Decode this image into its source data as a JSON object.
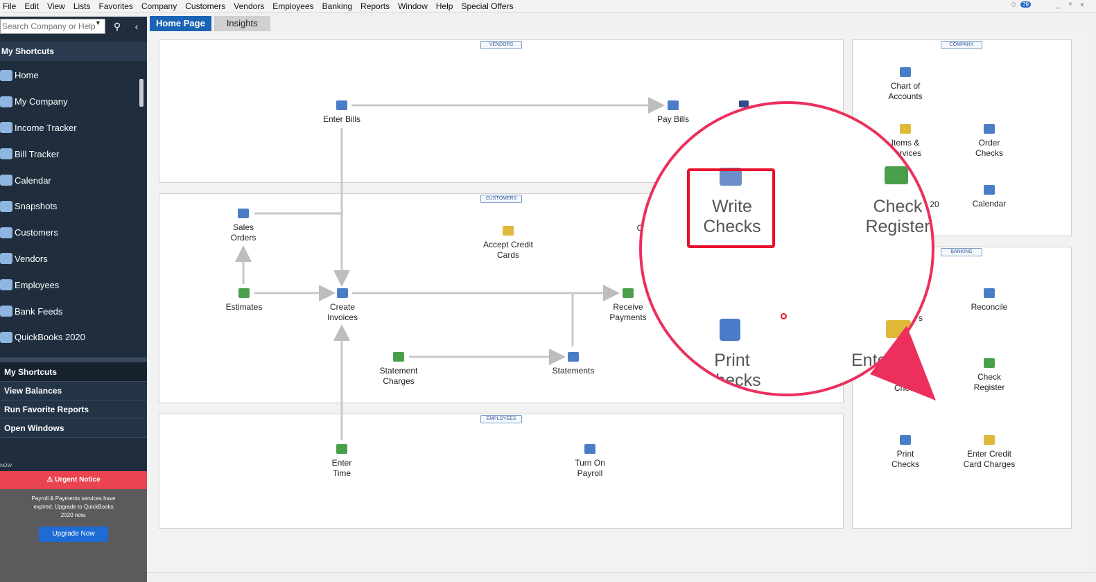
{
  "menu": [
    "File",
    "Edit",
    "View",
    "Lists",
    "Favorites",
    "Company",
    "Customers",
    "Vendors",
    "Employees",
    "Banking",
    "Reports",
    "Window",
    "Help",
    "Special Offers"
  ],
  "window_controls": {
    "badge": "79",
    "minimize": "_",
    "restore": "ᵒ",
    "close": "×"
  },
  "search": {
    "placeholder": "Search Company or Help"
  },
  "sidebar": {
    "header": "My Shortcuts",
    "items": [
      "Home",
      "My Company",
      "Income Tracker",
      "Bill Tracker",
      "Calendar",
      "Snapshots",
      "Customers",
      "Vendors",
      "Employees",
      "Bank Feeds",
      "QuickBooks 2020"
    ],
    "tabs": [
      "My Shortcuts",
      "View Balances",
      "Run Favorite Reports",
      "Open Windows"
    ],
    "now_label": "NOW",
    "notice": {
      "title": "Urgent Notice",
      "text": "Payroll & Payments services have expired. Upgrade to QuickBooks 2020 now.",
      "button": "Upgrade Now"
    }
  },
  "tabs": [
    "Home Page",
    "Insights"
  ],
  "panels": {
    "vendors": "VENDORS",
    "customers": "CUSTOMERS",
    "employees": "EMPLOYEES",
    "company": "COMPANY",
    "banking": "BANKING"
  },
  "nodes": {
    "enter_bills": "Enter Bills",
    "pay_bills": "Pay Bills",
    "sales_orders": "Sales Orders",
    "accept_cc": "Accept Credit Cards",
    "estimates": "Estimates",
    "create_invoices": "Create Invoices",
    "receive_payments": "Receive Payments",
    "statement_charges": "Statement Charges",
    "statements": "Statements",
    "enter_time": "Enter Time",
    "turn_on_payroll": "Turn On Payroll",
    "chart_of_accounts": "Chart of Accounts",
    "items_services": "Items & Services",
    "order_checks": "Order Checks",
    "qb2020_fragment": "20",
    "calendar": "Calendar",
    "reconcile": "Reconcile",
    "checks_fragment": "s",
    "write_checks_fragment": "Chec",
    "check_register": "Check Register",
    "print_checks": "Print Checks",
    "enter_cc_charges": "Enter Credit Card Charges",
    "cc_fragment": "C"
  },
  "zoom": {
    "write_checks": "Write Checks",
    "check_register": "Check Register",
    "print_checks": "Print Checks",
    "enter_fragment": "Ente C"
  }
}
